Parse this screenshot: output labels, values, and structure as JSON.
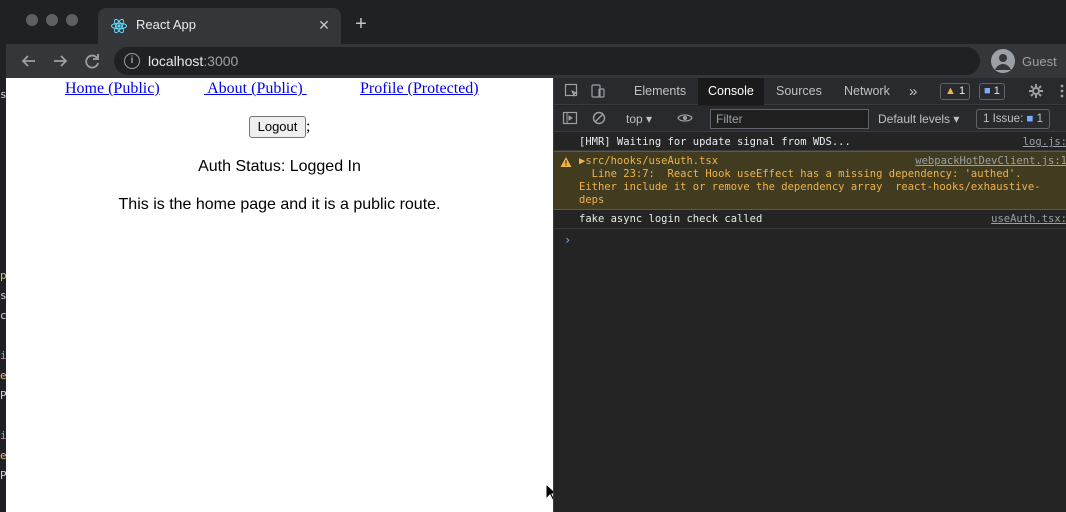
{
  "editor_strip": {
    "chars": [
      "se",
      "",
      "",
      "",
      "",
      "pr",
      "sr",
      "co",
      "",
      "in",
      "ex",
      "Pr",
      "",
      "in",
      "ex",
      "Pr"
    ]
  },
  "browser": {
    "tab": {
      "title": "React App"
    },
    "address": {
      "host": "localhost",
      "path": ":3000"
    },
    "profile": {
      "label": "Guest"
    }
  },
  "page": {
    "nav": {
      "home": "Home (Public)",
      "about": " About (Public) ",
      "profile": "Profile (Protected)"
    },
    "logout_label": "Logout",
    "semicolon": ";",
    "auth_status": "Auth Status: Logged In",
    "home_text": "This is the home page and it is a public route."
  },
  "devtools": {
    "tabs": [
      "Elements",
      "Console",
      "Sources",
      "Network"
    ],
    "active_tab": "Console",
    "overflow": "»",
    "warnings_count": "1",
    "messages_count": "1",
    "context": "top",
    "filter_placeholder": "Filter",
    "levels": "Default levels",
    "issues_label": "1 Issue:",
    "issues_count": "1",
    "console_messages": [
      {
        "text": "[HMR] Waiting for update signal from WDS...",
        "source": "log.js:"
      },
      {
        "text": "▶src/hooks/useAuth.tsx",
        "source": "webpackHotDevClient.js:1",
        "line2": "  Line 23:7:  React Hook useEffect has a missing dependency: 'authed'.",
        "line3": "Either include it or remove the dependency array  react-hooks/exhaustive-",
        "line4": "deps"
      },
      {
        "text": "fake async login check called",
        "source": "useAuth.tsx:"
      }
    ],
    "prompt": "›"
  },
  "colors": {
    "link": "#0000ee",
    "warning_text": "#f2b24c",
    "warning_bg": "#413b1f",
    "active_tab_bg": "#1a1a1a"
  }
}
